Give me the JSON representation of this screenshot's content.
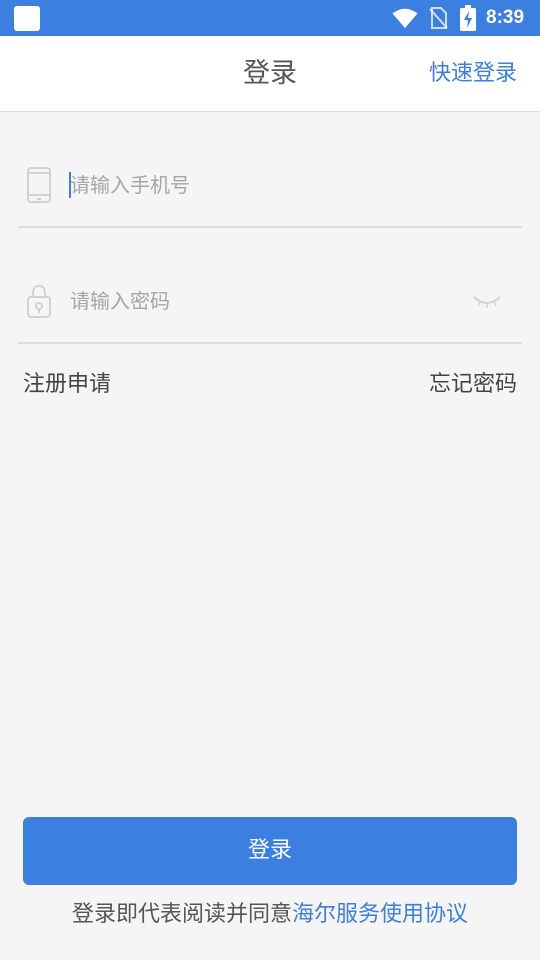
{
  "status_bar": {
    "time": "8:39",
    "icons": [
      "app-icon",
      "wifi-icon",
      "no-sim-icon",
      "battery-charging-icon"
    ],
    "background_color": "#3b7fe0"
  },
  "header": {
    "title": "登录",
    "quick_login_label": "快速登录"
  },
  "phone_field": {
    "icon": "phone-icon",
    "value": "",
    "placeholder": "请输入手机号"
  },
  "password_field": {
    "icon": "lock-icon",
    "value": "",
    "placeholder": "请输入密码",
    "toggle_icon": "eye-closed-icon"
  },
  "links": {
    "register_label": "注册申请",
    "forgot_label": "忘记密码"
  },
  "login_button": {
    "label": "登录"
  },
  "agreement": {
    "prefix": "登录即代表阅读并同意",
    "link_label": "海尔服务使用协议"
  },
  "colors": {
    "accent": "#3b7fe0",
    "background": "#f5f5f5",
    "divider": "#dedede"
  }
}
